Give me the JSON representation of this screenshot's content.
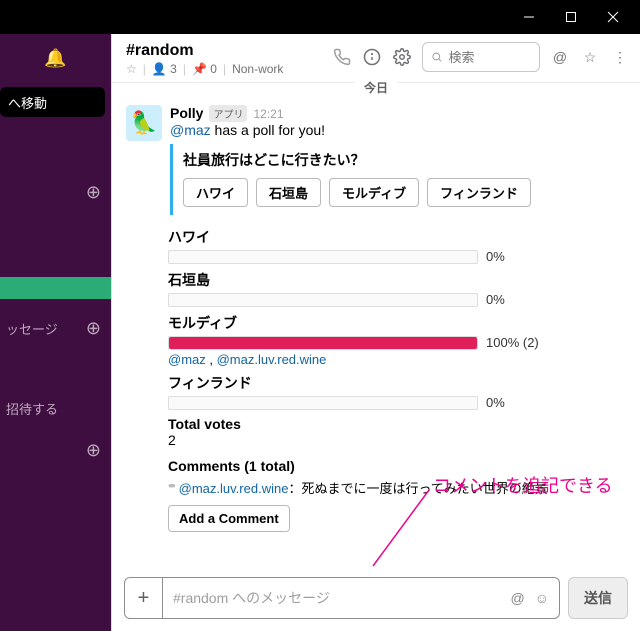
{
  "window": {
    "minimize": "–",
    "maximize": "□",
    "close": "×"
  },
  "sidebar": {
    "move": "へ移動",
    "messages": "ッセージ",
    "invite": "招待する"
  },
  "header": {
    "channel": "#random",
    "members": "3",
    "pins": "0",
    "topic": "Non-work",
    "search_placeholder": "検索"
  },
  "divider": "今日",
  "message": {
    "bot": "Polly",
    "app_tag": "アプリ",
    "time": "12:21",
    "mention": "@maz",
    "text": " has a poll for you!"
  },
  "poll": {
    "question": "社員旅行はどこに行きたい？",
    "options": [
      "ハワイ",
      "石垣島",
      "モルディブ",
      "フィンランド"
    ],
    "results": [
      {
        "label": "ハワイ",
        "pct": "0%",
        "fill": 0
      },
      {
        "label": "石垣島",
        "pct": "0%",
        "fill": 0
      },
      {
        "label": "モルディブ",
        "pct": "100% (2)",
        "fill": 100,
        "voters": [
          "@maz",
          "@maz.luv.red.wine"
        ]
      },
      {
        "label": "フィンランド",
        "pct": "0%",
        "fill": 0
      }
    ],
    "total_label": "Total votes",
    "total_value": "2",
    "comments_title": "Comments (1 total)",
    "comment_user": "@maz.luv.red.wine",
    "comment_text": "：死ぬまでに一度は行ってみたい世界の絶景",
    "add_comment": "Add a Comment"
  },
  "annotation": "コメントを追記できる",
  "composer": {
    "placeholder": "#random へのメッセージ",
    "send": "送信"
  }
}
